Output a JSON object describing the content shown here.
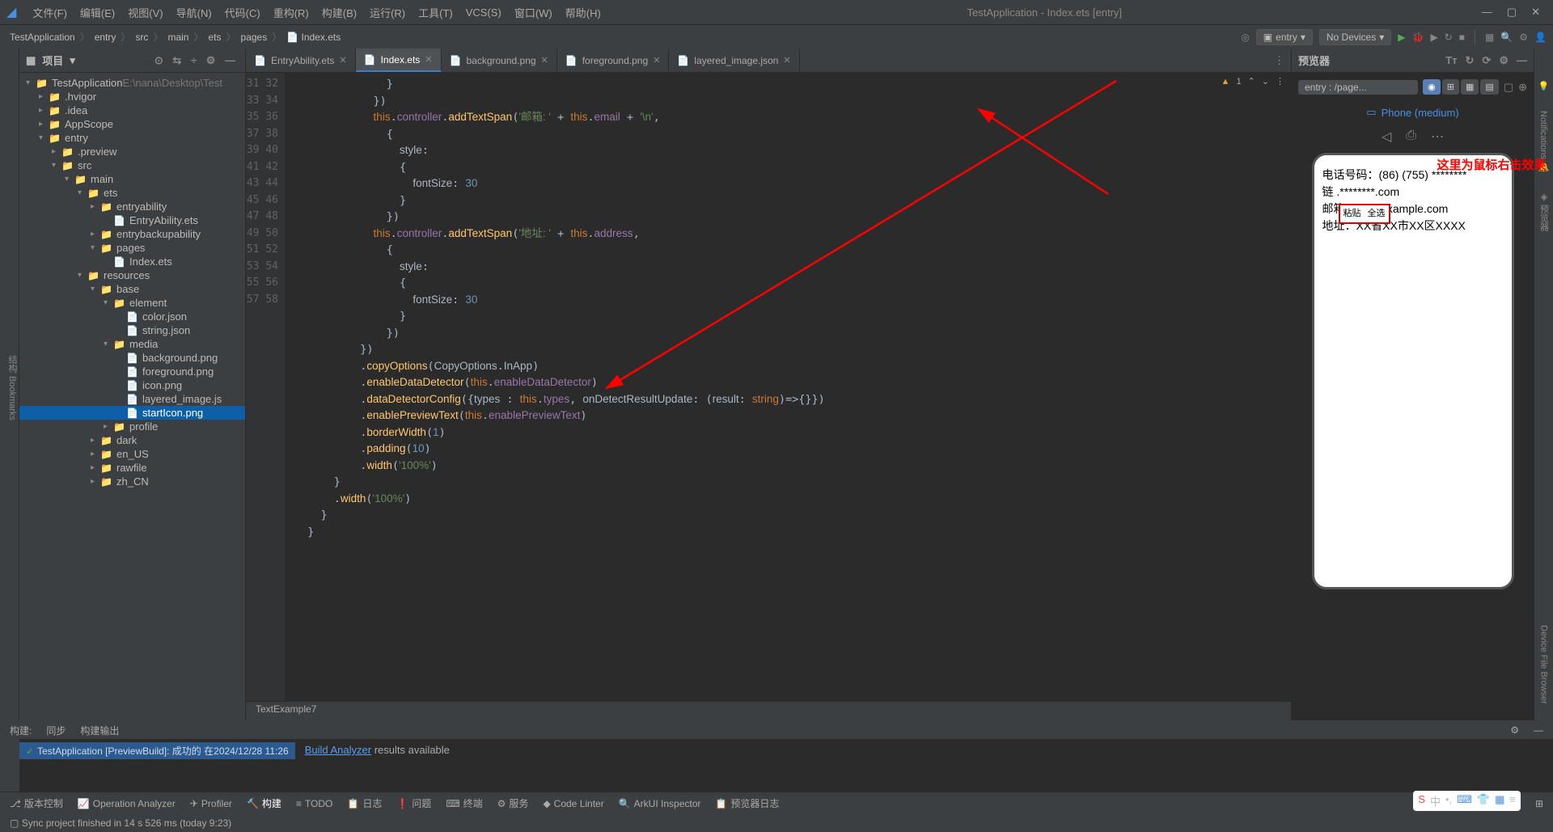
{
  "title": "TestApplication - Index.ets [entry]",
  "menu": [
    "文件(F)",
    "编辑(E)",
    "视图(V)",
    "导航(N)",
    "代码(C)",
    "重构(R)",
    "构建(B)",
    "运行(R)",
    "工具(T)",
    "VCS(S)",
    "窗口(W)",
    "帮助(H)"
  ],
  "window_controls": [
    "—",
    "▢",
    "✕"
  ],
  "breadcrumbs": [
    "TestApplication",
    "entry",
    "src",
    "main",
    "ets",
    "pages",
    "Index.ets"
  ],
  "run_config": "entry",
  "device_combo": "No Devices",
  "project_panel": {
    "title": "项目"
  },
  "tree": [
    {
      "d": 0,
      "c": "▾",
      "i": "📁",
      "t": "TestApplication",
      "dim": "E:\\nana\\Desktop\\Test"
    },
    {
      "d": 1,
      "c": "▸",
      "i": "📁",
      "t": ".hvigor"
    },
    {
      "d": 1,
      "c": "▸",
      "i": "📁",
      "t": ".idea"
    },
    {
      "d": 1,
      "c": "▸",
      "i": "📁",
      "t": "AppScope"
    },
    {
      "d": 1,
      "c": "▾",
      "i": "📁",
      "t": "entry"
    },
    {
      "d": 2,
      "c": "▸",
      "i": "📁",
      "t": ".preview"
    },
    {
      "d": 2,
      "c": "▾",
      "i": "📁",
      "t": "src"
    },
    {
      "d": 3,
      "c": "▾",
      "i": "📁",
      "t": "main"
    },
    {
      "d": 4,
      "c": "▾",
      "i": "📁",
      "t": "ets"
    },
    {
      "d": 5,
      "c": "▸",
      "i": "📁",
      "t": "entryability"
    },
    {
      "d": 6,
      "c": "",
      "i": "📄",
      "t": "EntryAbility.ets"
    },
    {
      "d": 5,
      "c": "▸",
      "i": "📁",
      "t": "entrybackupability"
    },
    {
      "d": 5,
      "c": "▾",
      "i": "📁",
      "t": "pages"
    },
    {
      "d": 6,
      "c": "",
      "i": "📄",
      "t": "Index.ets"
    },
    {
      "d": 4,
      "c": "▾",
      "i": "📁",
      "t": "resources"
    },
    {
      "d": 5,
      "c": "▾",
      "i": "📁",
      "t": "base"
    },
    {
      "d": 6,
      "c": "▾",
      "i": "📁",
      "t": "element"
    },
    {
      "d": 7,
      "c": "",
      "i": "📄",
      "t": "color.json"
    },
    {
      "d": 7,
      "c": "",
      "i": "📄",
      "t": "string.json"
    },
    {
      "d": 6,
      "c": "▾",
      "i": "📁",
      "t": "media"
    },
    {
      "d": 7,
      "c": "",
      "i": "📄",
      "t": "background.png"
    },
    {
      "d": 7,
      "c": "",
      "i": "📄",
      "t": "foreground.png"
    },
    {
      "d": 7,
      "c": "",
      "i": "📄",
      "t": "icon.png"
    },
    {
      "d": 7,
      "c": "",
      "i": "📄",
      "t": "layered_image.js"
    },
    {
      "d": 7,
      "c": "",
      "i": "📄",
      "t": "startIcon.png",
      "sel": true
    },
    {
      "d": 6,
      "c": "▸",
      "i": "📁",
      "t": "profile"
    },
    {
      "d": 5,
      "c": "▸",
      "i": "📁",
      "t": "dark"
    },
    {
      "d": 5,
      "c": "▸",
      "i": "📁",
      "t": "en_US"
    },
    {
      "d": 5,
      "c": "▸",
      "i": "📁",
      "t": "rawfile"
    },
    {
      "d": 5,
      "c": "▸",
      "i": "📁",
      "t": "zh_CN"
    }
  ],
  "tabs": [
    {
      "label": "EntryAbility.ets"
    },
    {
      "label": "Index.ets",
      "active": true
    },
    {
      "label": "background.png"
    },
    {
      "label": "foreground.png"
    },
    {
      "label": "layered_image.json"
    }
  ],
  "line_start": 31,
  "line_end": 58,
  "warn_count": "1",
  "code_crumb": "TextExample7",
  "preview": {
    "title": "预览器",
    "entry": "entry : /page...",
    "device": "Phone (medium)",
    "annot": "这里为鼠标右击效果",
    "ctx": [
      "粘贴",
      "全选"
    ],
    "lines": [
      "电话号码：(86) (755) ********",
      "链                .********.com",
      "邮箱：***@example.com",
      "地址：XX省XX市XX区XXXX"
    ]
  },
  "build_tabs": [
    "构建:",
    "同步",
    "构建输出"
  ],
  "build_success": "TestApplication [PreviewBuild]: 成功的 在2024/12/28 11:26",
  "build_msg_link": "Build Analyzer",
  "build_msg_rest": " results available",
  "bottom_tools": [
    {
      "i": "⎇",
      "t": "版本控制"
    },
    {
      "i": "📈",
      "t": "Operation Analyzer"
    },
    {
      "i": "✈",
      "t": "Profiler"
    },
    {
      "i": "🔨",
      "t": "构建",
      "active": true
    },
    {
      "i": "≡",
      "t": "TODO"
    },
    {
      "i": "📋",
      "t": "日志"
    },
    {
      "i": "❗",
      "t": "问题"
    },
    {
      "i": "⌨",
      "t": "终端"
    },
    {
      "i": "⚙",
      "t": "服务"
    },
    {
      "i": "◆",
      "t": "Code Linter"
    },
    {
      "i": "🔍",
      "t": "ArkUI Inspector"
    },
    {
      "i": "📋",
      "t": "预览器日志"
    }
  ],
  "status": "Sync project finished in 14 s 526 ms (today 9:23)"
}
